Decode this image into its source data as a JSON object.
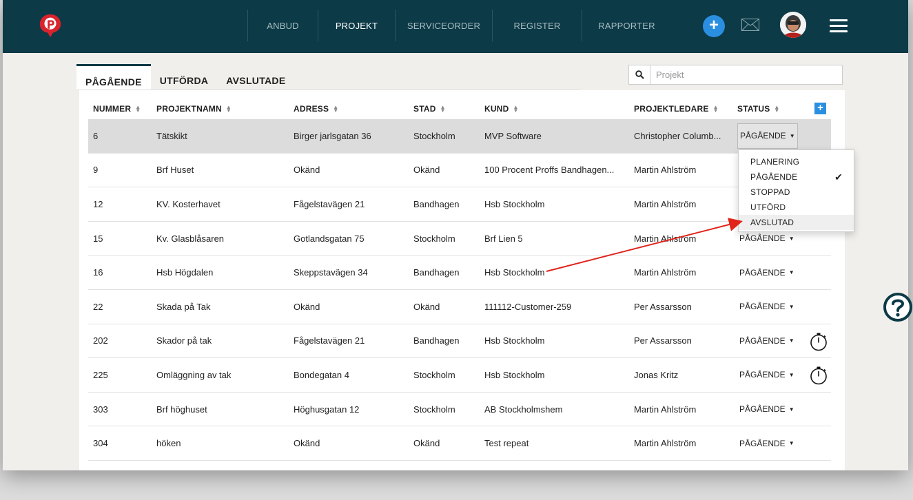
{
  "nav": {
    "items": [
      "ANBUD",
      "PROJEKT",
      "SERVICEORDER",
      "REGISTER",
      "RAPPORTER"
    ],
    "active": "PROJEKT"
  },
  "tabs": [
    "PÅGÅENDE",
    "UTFÖRDA",
    "AVSLUTADE"
  ],
  "search": {
    "placeholder": "Projekt"
  },
  "columns": [
    "NUMMER",
    "PROJEKTNAMN",
    "ADRESS",
    "STAD",
    "KUND",
    "PROJEKTLEDARE",
    "STATUS"
  ],
  "rows": [
    {
      "num": "6",
      "name": "Tätskikt",
      "addr": "Birger jarlsgatan 36",
      "city": "Stockholm",
      "cust": "MVP Software",
      "lead": "Christopher Columb...",
      "status": "PÅGÅENDE"
    },
    {
      "num": "9",
      "name": "Brf Huset",
      "addr": "Okänd",
      "city": "Okänd",
      "cust": "100 Procent Proffs Bandhagen...",
      "lead": "Martin Ahlström",
      "status": ""
    },
    {
      "num": "12",
      "name": "KV. Kosterhavet",
      "addr": "Fågelstavägen 21",
      "city": "Bandhagen",
      "cust": "Hsb Stockholm",
      "lead": "Martin Ahlström",
      "status": ""
    },
    {
      "num": "15",
      "name": "Kv. Glasblåsaren",
      "addr": "Gotlandsgatan 75",
      "city": "Stockholm",
      "cust": "Brf Lien 5",
      "lead": "Martin Ahlström",
      "status": "PÅGÅENDE"
    },
    {
      "num": "16",
      "name": "Hsb Högdalen",
      "addr": "Skeppstavägen 34",
      "city": "Bandhagen",
      "cust": "Hsb Stockholm",
      "lead": "Martin Ahlström",
      "status": "PÅGÅENDE"
    },
    {
      "num": "22",
      "name": "Skada på Tak",
      "addr": "Okänd",
      "city": "Okänd",
      "cust": "111112-Customer-259",
      "lead": "Per Assarsson",
      "status": "PÅGÅENDE"
    },
    {
      "num": "202",
      "name": "Skador på tak",
      "addr": "Fågelstavägen 21",
      "city": "Bandhagen",
      "cust": "Hsb Stockholm",
      "lead": "Per Assarsson",
      "status": "PÅGÅENDE"
    },
    {
      "num": "225",
      "name": "Omläggning av tak",
      "addr": "Bondegatan 4",
      "city": "Stockholm",
      "cust": "Hsb Stockholm",
      "lead": "Jonas Kritz",
      "status": "PÅGÅENDE"
    },
    {
      "num": "303",
      "name": "Brf höghuset",
      "addr": "Höghusgatan 12",
      "city": "Stockholm",
      "cust": "AB Stockholmshem",
      "lead": "Martin Ahlström",
      "status": "PÅGÅENDE"
    },
    {
      "num": "304",
      "name": "höken",
      "addr": "Okänd",
      "city": "Okänd",
      "cust": "Test repeat",
      "lead": "Martin Ahlström",
      "status": "PÅGÅENDE"
    }
  ],
  "dropdown": {
    "items": [
      "PLANERING",
      "PÅGÅENDE",
      "STOPPAD",
      "UTFÖRD",
      "AVSLUTAD"
    ],
    "checked": "PÅGÅENDE",
    "hovered": "AVSLUTAD"
  },
  "colors": {
    "topbar": "#0c3a47",
    "accent": "#2a8fe0",
    "arrow": "#e0241b",
    "logo": "#d9232d"
  },
  "icons": [
    "logo-icon",
    "add-icon",
    "mail-icon",
    "avatar",
    "menu-icon",
    "search-icon",
    "sort-icon",
    "add-column-icon",
    "timer-icon",
    "check-icon",
    "help-icon"
  ]
}
